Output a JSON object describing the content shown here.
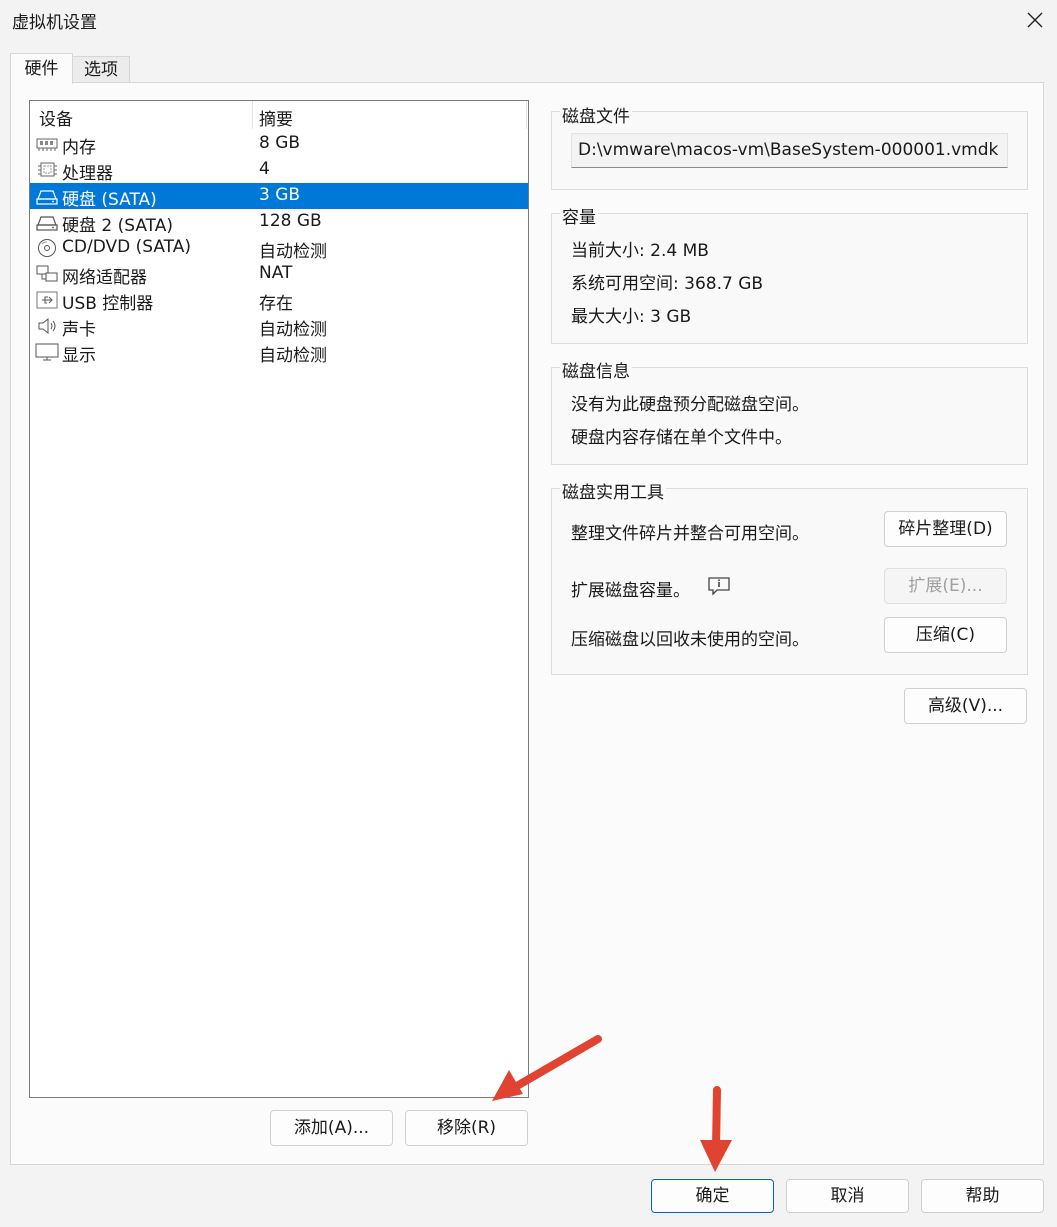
{
  "window": {
    "title": "虚拟机设置"
  },
  "tabs": [
    {
      "label": "硬件"
    },
    {
      "label": "选项"
    }
  ],
  "device_list": {
    "columns": [
      "设备",
      "摘要"
    ],
    "rows": [
      {
        "name": "内存",
        "summary": "8 GB",
        "icon": "memory-icon"
      },
      {
        "name": "处理器",
        "summary": "4",
        "icon": "processor-icon"
      },
      {
        "name": "硬盘 (SATA)",
        "summary": "3 GB",
        "icon": "hard-disk-icon",
        "selected": true
      },
      {
        "name": "硬盘 2 (SATA)",
        "summary": "128 GB",
        "icon": "hard-disk-icon"
      },
      {
        "name": "CD/DVD (SATA)",
        "summary": "自动检测",
        "icon": "cd-dvd-icon"
      },
      {
        "name": "网络适配器",
        "summary": "NAT",
        "icon": "network-adapter-icon"
      },
      {
        "name": "USB 控制器",
        "summary": "存在",
        "icon": "usb-icon"
      },
      {
        "name": "声卡",
        "summary": "自动检测",
        "icon": "speaker-icon"
      },
      {
        "name": "显示",
        "summary": "自动检测",
        "icon": "monitor-icon"
      }
    ]
  },
  "list_buttons": {
    "add": "添加(A)...",
    "remove": "移除(R)"
  },
  "disk_file": {
    "title": "磁盘文件",
    "path": "D:\\vmware\\macos-vm\\BaseSystem-000001.vmdk"
  },
  "capacity": {
    "title": "容量",
    "current_label": "当前大小:",
    "current_value": "2.4 MB",
    "available_label": "系统可用空间:",
    "available_value": "368.7 GB",
    "max_label": "最大大小:",
    "max_value": "3 GB"
  },
  "disk_info": {
    "title": "磁盘信息",
    "line1": "没有为此硬盘预分配磁盘空间。",
    "line2": "硬盘内容存储在单个文件中。"
  },
  "disk_utilities": {
    "title": "磁盘实用工具",
    "defrag_text": "整理文件碎片并整合可用空间。",
    "defrag_button": "碎片整理(D)",
    "expand_text": "扩展磁盘容量。",
    "expand_button": "扩展(E)...",
    "compact_text": "压缩磁盘以回收未使用的空间。",
    "compact_button": "压缩(C)"
  },
  "advanced_button": "高级(V)...",
  "footer": {
    "ok": "确定",
    "cancel": "取消",
    "help": "帮助"
  },
  "colors": {
    "selection": "#0078d7",
    "annotation_arrow": "#e0432f"
  }
}
